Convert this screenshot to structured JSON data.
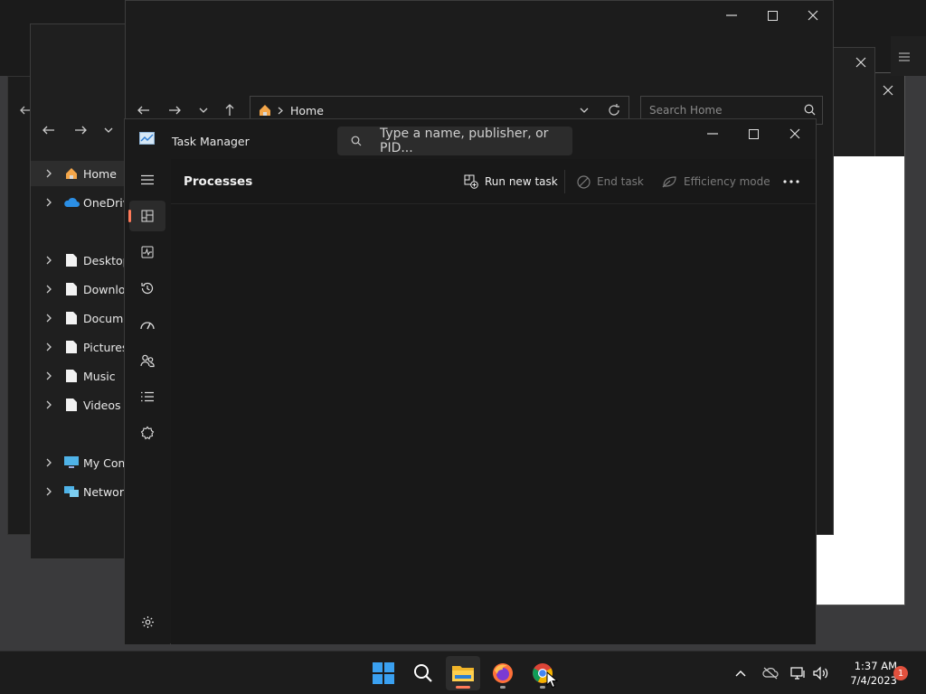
{
  "explorer_back": {
    "tree": [
      {
        "label": "Home",
        "icon": "home-icon",
        "selected": true
      },
      {
        "label": "OneDrive",
        "icon": "cloud-icon"
      },
      {
        "label": "Desktop",
        "icon": "document-icon"
      },
      {
        "label": "Downloa",
        "icon": "document-icon"
      },
      {
        "label": "Documer",
        "icon": "document-icon"
      },
      {
        "label": "Pictures",
        "icon": "document-icon"
      },
      {
        "label": "Music",
        "icon": "document-icon"
      },
      {
        "label": "Videos",
        "icon": "document-icon"
      },
      {
        "label": "My Comp",
        "icon": "computer-icon"
      },
      {
        "label": "Network",
        "icon": "network-icon"
      }
    ]
  },
  "explorer_front": {
    "breadcrumb_home": "Home",
    "search_placeholder": "Search Home"
  },
  "task_manager": {
    "title": "Task Manager",
    "search_placeholder": "Type a name, publisher, or PID...",
    "page_title": "Processes",
    "run_new_task": "Run new task",
    "end_task": "End task",
    "efficiency_mode": "Efficiency mode",
    "nav": [
      "processes-icon",
      "performance-icon",
      "app-history-icon",
      "startup-apps-icon",
      "users-icon",
      "details-icon",
      "services-icon"
    ]
  },
  "taskbar": {
    "apps": [
      "start-icon",
      "search-icon",
      "file-explorer-icon",
      "firefox-icon",
      "chrome-icon"
    ],
    "time": "1:37 AM",
    "date": "7/4/2023",
    "notification_count": "1"
  },
  "colors": {
    "accent": "#ff7a59",
    "folder": "#f0b429",
    "notification": "#e1513e"
  }
}
